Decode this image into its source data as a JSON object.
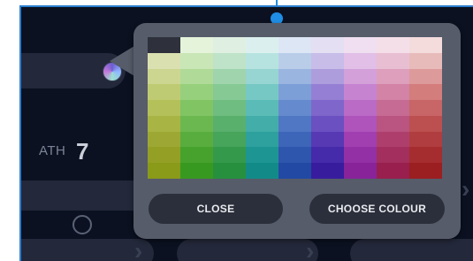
{
  "background": {
    "path_label": "ATH",
    "path_number": "7"
  },
  "palette": {
    "rows": [
      [
        "#2e313c",
        "#e5f3da",
        "#dff0e2",
        "#dbf0ee",
        "#dce6f5",
        "#e4dff3",
        "#f0dff1",
        "#f4dfe9",
        "#f4dcdc"
      ],
      [
        "#dbe0b0",
        "#c9e6b7",
        "#bfe3c8",
        "#b6e3e0",
        "#b9cde9",
        "#c7bde8",
        "#e1bfe6",
        "#e8bfd2",
        "#e8bbbb"
      ],
      [
        "#ccd690",
        "#b0da98",
        "#9fd4ad",
        "#96d5d1",
        "#9ab5e0",
        "#ae9ddd",
        "#d3a0da",
        "#dd9fbb",
        "#dd9a9a"
      ],
      [
        "#bfcb72",
        "#97d07c",
        "#86c995",
        "#76c8c4",
        "#7d9fd8",
        "#957fd4",
        "#c684d0",
        "#d283a6",
        "#d37d7d"
      ],
      [
        "#b4c05a",
        "#81c464",
        "#6fbd80",
        "#5bbbb7",
        "#658bce",
        "#7f66ca",
        "#ba6bc6",
        "#c66b93",
        "#c86566"
      ],
      [
        "#a8b443",
        "#6cb850",
        "#59b06d",
        "#42ada9",
        "#4f77c3",
        "#6a50c0",
        "#ae54bb",
        "#ba5480",
        "#bc5051"
      ],
      [
        "#9da834",
        "#58ad3e",
        "#46a45b",
        "#2ea09d",
        "#3d65b8",
        "#5739b4",
        "#a13fb0",
        "#ae3f6d",
        "#b03d3f"
      ],
      [
        "#93a025",
        "#46a22c",
        "#35994c",
        "#1d9592",
        "#2e56ad",
        "#452aa9",
        "#9430a5",
        "#a22f5d",
        "#a52d2f"
      ],
      [
        "#8a9a19",
        "#389920",
        "#27903e",
        "#128b88",
        "#2249a3",
        "#371c9e",
        "#88239a",
        "#981f4e",
        "#9b1e21"
      ]
    ]
  },
  "buttons": {
    "close_label": "CLOSE",
    "choose_label": "CHOOSE COLOUR"
  }
}
